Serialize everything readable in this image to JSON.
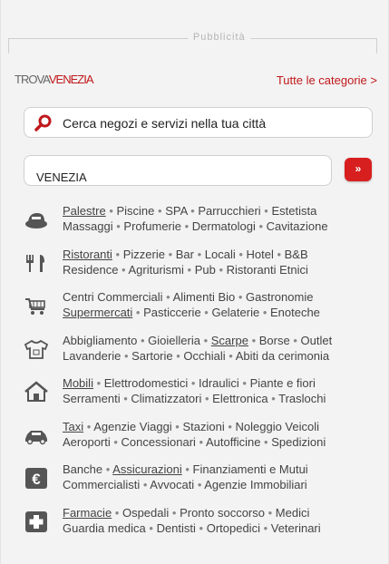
{
  "ad": {
    "label": "Pubblicità"
  },
  "brand": {
    "trova": "TROVA",
    "city": "VENEZIA"
  },
  "all_categories_link": "Tutte le categorie >",
  "search": {
    "placeholder": "Cerca negozi e servizi nella tua città"
  },
  "city": {
    "value": "VENEZIA"
  },
  "go_button": "»",
  "categories": [
    {
      "icon": "sport-cap-icon",
      "lines": [
        [
          "Palestre",
          "Piscine",
          "SPA",
          "Parrucchieri",
          "Estetista"
        ],
        [
          "Massaggi",
          "Profumerie",
          "Dermatologi",
          "Cavitazione"
        ]
      ],
      "underlined": "Palestre"
    },
    {
      "icon": "fork-knife-icon",
      "lines": [
        [
          "Ristoranti",
          "Pizzerie",
          "Bar",
          "Locali",
          "Hotel",
          "B&B"
        ],
        [
          "Residence",
          "Agriturismi",
          "Pub",
          "Ristoranti Etnici"
        ]
      ],
      "underlined": "Ristoranti"
    },
    {
      "icon": "shopping-cart-icon",
      "lines": [
        [
          "Centri Commerciali",
          "Alimenti Bio",
          "Gastronomie"
        ],
        [
          "Supermercati",
          "Pasticcerie",
          "Gelaterie",
          "Enoteche"
        ]
      ],
      "underlined": "Supermercati"
    },
    {
      "icon": "tshirt-icon",
      "lines": [
        [
          "Abbigliamento",
          "Gioielleria",
          "Scarpe",
          "Borse",
          "Outlet"
        ],
        [
          "Lavanderie",
          "Sartorie",
          "Occhiali",
          "Abiti da cerimonia"
        ]
      ],
      "underlined": "Scarpe"
    },
    {
      "icon": "house-icon",
      "lines": [
        [
          "Mobili",
          "Elettrodomestici",
          "Idraulici",
          "Piante e fiori"
        ],
        [
          "Serramenti",
          "Climatizzatori",
          "Elettronica",
          "Traslochi"
        ]
      ],
      "underlined": "Mobili"
    },
    {
      "icon": "car-icon",
      "lines": [
        [
          "Taxi",
          "Agenzie Viaggi",
          "Stazioni",
          "Noleggio Veicoli"
        ],
        [
          "Aeroporti",
          "Concessionari",
          "Autofficine",
          "Spedizioni"
        ]
      ],
      "underlined": "Taxi"
    },
    {
      "icon": "euro-icon",
      "lines": [
        [
          "Banche",
          "Assicurazioni",
          "Finanziamenti e Mutui"
        ],
        [
          "Commercialisti",
          "Avvocati",
          "Agenzie Immobiliari"
        ]
      ],
      "underlined": "Assicurazioni"
    },
    {
      "icon": "medical-cross-icon",
      "lines": [
        [
          "Farmacie",
          "Ospedali",
          "Pronto soccorso",
          "Medici"
        ],
        [
          "Guardia medica",
          "Dentisti",
          "Ortopedici",
          "Veterinari"
        ]
      ],
      "underlined": "Farmacie"
    }
  ],
  "colors": {
    "accent": "#c0181b",
    "button": "#d81f1f",
    "icon": "#555555"
  }
}
